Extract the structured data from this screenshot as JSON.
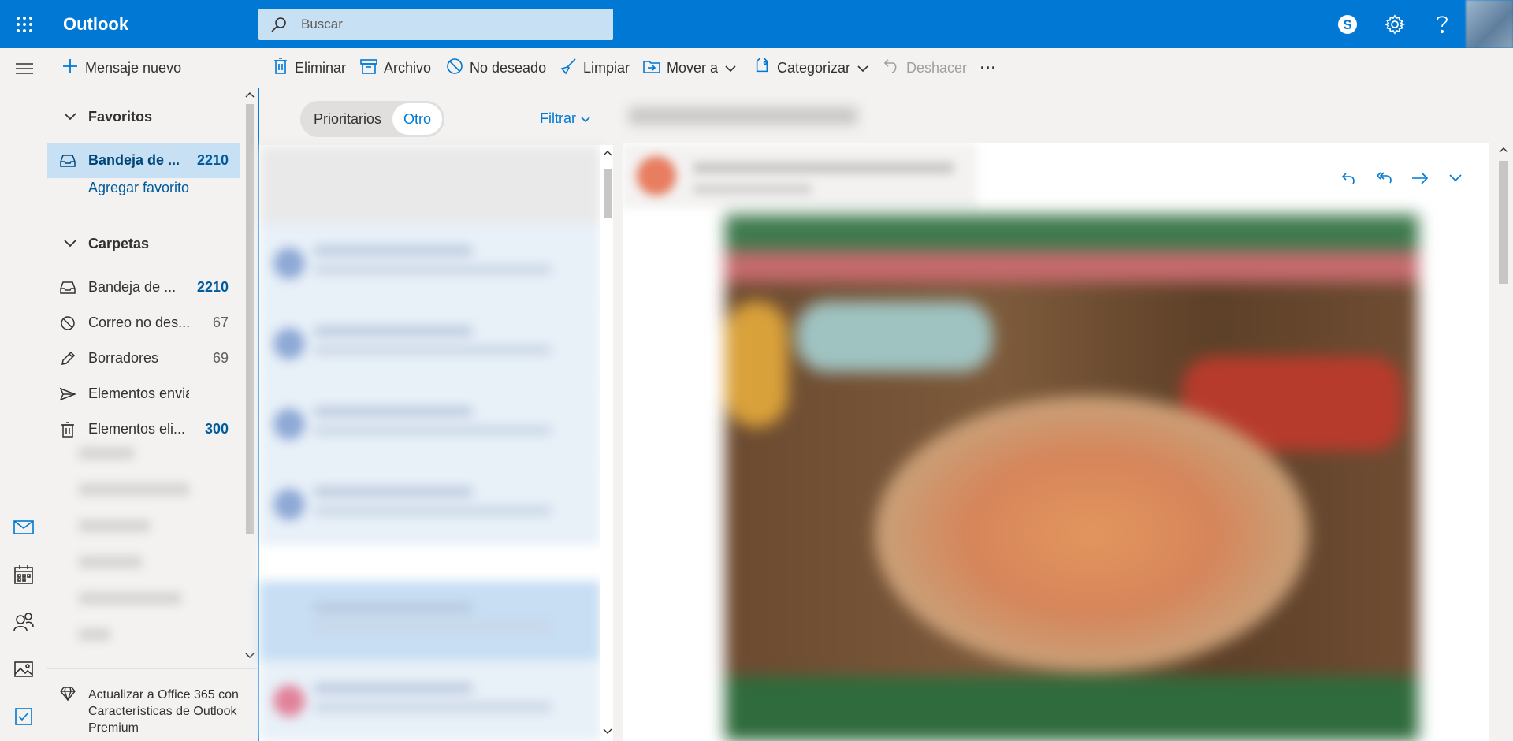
{
  "app": {
    "title": "Outlook"
  },
  "search": {
    "placeholder": "Buscar"
  },
  "topbar": {
    "icons": [
      "skype-icon",
      "settings-gear-icon",
      "help-icon",
      "avatar"
    ]
  },
  "commands": {
    "new_message": "Mensaje nuevo",
    "delete": "Eliminar",
    "archive": "Archivo",
    "junk": "No deseado",
    "sweep": "Limpiar",
    "move_to": "Mover a",
    "categorize": "Categorizar",
    "undo": "Deshacer",
    "more": "···"
  },
  "folders": {
    "favorites_header": "Favoritos",
    "favorites": [
      {
        "name": "Bandeja de ...",
        "count": "2210",
        "icon": "inbox-icon",
        "selected": true
      }
    ],
    "add_favorite": "Agregar favorito",
    "folders_header": "Carpetas",
    "items": [
      {
        "name": "Bandeja de ...",
        "count": "2210",
        "icon": "inbox-icon"
      },
      {
        "name": "Correo no des...",
        "count": "67",
        "icon": "junk-icon"
      },
      {
        "name": "Borradores",
        "count": "69",
        "icon": "pencil-icon"
      },
      {
        "name": "Elementos envia...",
        "count": "",
        "icon": "send-icon"
      },
      {
        "name": "Elementos eli...",
        "count": "300",
        "icon": "trash-icon"
      }
    ],
    "upgrade_text": "Actualizar a Office 365 con Características de Outlook Premium"
  },
  "message_list": {
    "tab_focused": "Prioritarios",
    "tab_other": "Otro",
    "active_tab": "Otro",
    "filter": "Filtrar"
  },
  "colors": {
    "accent": "#0078d4",
    "selected_bg": "#c7e0f4",
    "count_blue": "#005a9e"
  }
}
